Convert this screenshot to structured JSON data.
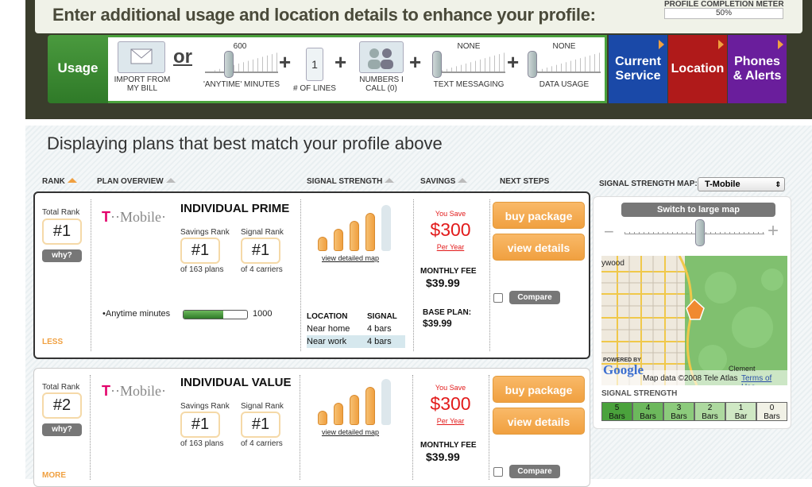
{
  "header": {
    "title": "Enter additional usage and location details to enhance your profile:",
    "meter_label": "PROFILE COMPLETION METER",
    "meter_value": "50%"
  },
  "usage_bar": {
    "usage_tab": "Usage",
    "import_label": "IMPORT FROM MY BILL",
    "or": "or",
    "anytime_value": "600",
    "anytime_label": "'ANYTIME' MINUTES",
    "plus": "+",
    "lines_value": "1",
    "lines_label": "# OF LINES",
    "numbers_label": "NUMBERS I CALL (0)",
    "text_value": "NONE",
    "text_label": "TEXT MESSAGING",
    "data_value": "NONE",
    "data_label": "DATA USAGE",
    "tabs": [
      {
        "label": "Current\nService",
        "color": "#1a49a8"
      },
      {
        "label": "Location",
        "color": "#b01a1a"
      },
      {
        "label": "Phones\n& Alerts",
        "color": "#6a1e9c"
      }
    ]
  },
  "results": {
    "subtitle": "Displaying plans that best match your profile above",
    "columns": {
      "rank": "RANK",
      "plan_overview": "PLAN OVERVIEW",
      "signal_strength": "SIGNAL STRENGTH",
      "savings": "SAVINGS",
      "next_steps": "NEXT STEPS"
    }
  },
  "plans": [
    {
      "total_rank_label": "Total Rank",
      "total_rank": "#1",
      "why": "why?",
      "toggle": "LESS",
      "carrier_t": "T",
      "carrier_rest": "··Mobile·",
      "name": "INDIVIDUAL PRIME",
      "savings_rank_label": "Savings Rank",
      "savings_rank": "#1",
      "savings_rank_of": "of 163 plans",
      "signal_rank_label": "Signal Rank",
      "signal_rank": "#1",
      "signal_rank_of": "of 4 carriers",
      "anytime_label": "•Anytime minutes",
      "anytime_value": "1000",
      "view_map": "view detailed map",
      "signal_level": 4,
      "loc_head": "LOCATION",
      "sig_head": "SIGNAL",
      "locations": [
        {
          "name": "Near home",
          "signal": "4 bars"
        },
        {
          "name": "Near work",
          "signal": "4 bars"
        }
      ],
      "you_save": "You Save",
      "savings_amount": "$300",
      "per_year": "Per Year",
      "monthly_fee_label": "MONTHLY FEE",
      "monthly_fee": "$39.99",
      "base_plan_label": "BASE PLAN:",
      "base_plan": "$39.99",
      "buy": "buy package",
      "details": "view details",
      "compare": "Compare"
    },
    {
      "total_rank_label": "Total Rank",
      "total_rank": "#2",
      "why": "why?",
      "toggle": "MORE",
      "carrier_t": "T",
      "carrier_rest": "··Mobile·",
      "name": "INDIVIDUAL VALUE",
      "savings_rank_label": "Savings Rank",
      "savings_rank": "#1",
      "savings_rank_of": "of 163 plans",
      "signal_rank_label": "Signal Rank",
      "signal_rank": "#1",
      "signal_rank_of": "of 4 carriers",
      "view_map": "view detailed map",
      "signal_level": 4,
      "you_save": "You Save",
      "savings_amount": "$300",
      "per_year": "Per Year",
      "monthly_fee_label": "MONTHLY FEE",
      "monthly_fee": "$39.99",
      "buy": "buy package",
      "details": "view details",
      "compare": "Compare"
    }
  ],
  "map_panel": {
    "label": "SIGNAL STRENGTH MAP:",
    "carrier_selected": "T-Mobile",
    "switch_button": "Switch to large map",
    "zoom_minus": "−",
    "zoom_plus": "+",
    "map_place": "ywood",
    "map_place2": "Clement",
    "map_brand": "Google",
    "powered_by": "POWERED BY",
    "map_credit": "Map data ©2008 Tele Atlas",
    "terms": "Terms of Use",
    "legend_title": "SIGNAL STRENGTH",
    "legend": [
      {
        "n": "5",
        "label": "Bars",
        "color": "#4aa23c"
      },
      {
        "n": "4",
        "label": "Bars",
        "color": "#6cb85c"
      },
      {
        "n": "3",
        "label": "Bars",
        "color": "#8ccb7c"
      },
      {
        "n": "2",
        "label": "Bars",
        "color": "#add99f"
      },
      {
        "n": "1",
        "label": "Bar",
        "color": "#cfe8c4"
      },
      {
        "n": "0",
        "label": "Bars",
        "color": "#f1f1e6"
      }
    ]
  }
}
